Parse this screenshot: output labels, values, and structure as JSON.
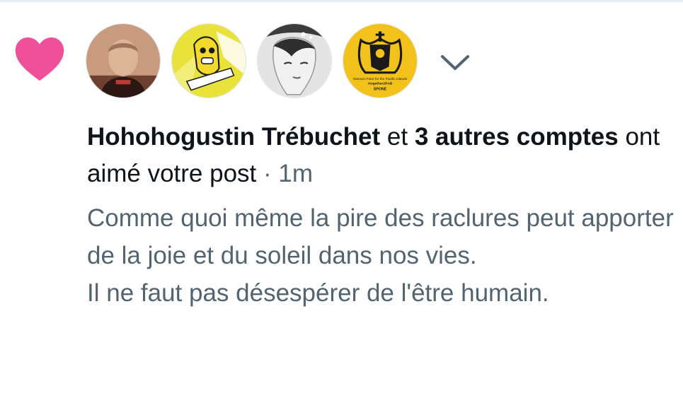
{
  "notification": {
    "actor_name": "Hohohogustin Trébuchet",
    "connector": "et",
    "others_count": "3 autres comptes",
    "action_text": "ont aimé votre post",
    "separator": "·",
    "time": "1m",
    "post_text": "Comme quoi même la pire des raclures peut apporter de la joie et du soleil dans nos vies.\nIl ne faut pas désespérer de l'être humain."
  },
  "icons": {
    "like": "heart-icon",
    "expand": "chevron-down-icon"
  },
  "colors": {
    "like_pink": "#f0509a",
    "text_primary": "#0f1419",
    "text_secondary": "#536471",
    "avatar_yellow": "#f3c21a"
  },
  "avatars": [
    {
      "name": "avatar-sepia-portrait"
    },
    {
      "name": "avatar-yellow-cartoon"
    },
    {
      "name": "avatar-grey-woman-illustration"
    },
    {
      "name": "avatar-yellow-emblem",
      "emblem_caption": "Samoan Fans for the Pacific Islands",
      "emblem_hashtag": "#together2RAB",
      "emblem_brand": "SPONE"
    }
  ]
}
